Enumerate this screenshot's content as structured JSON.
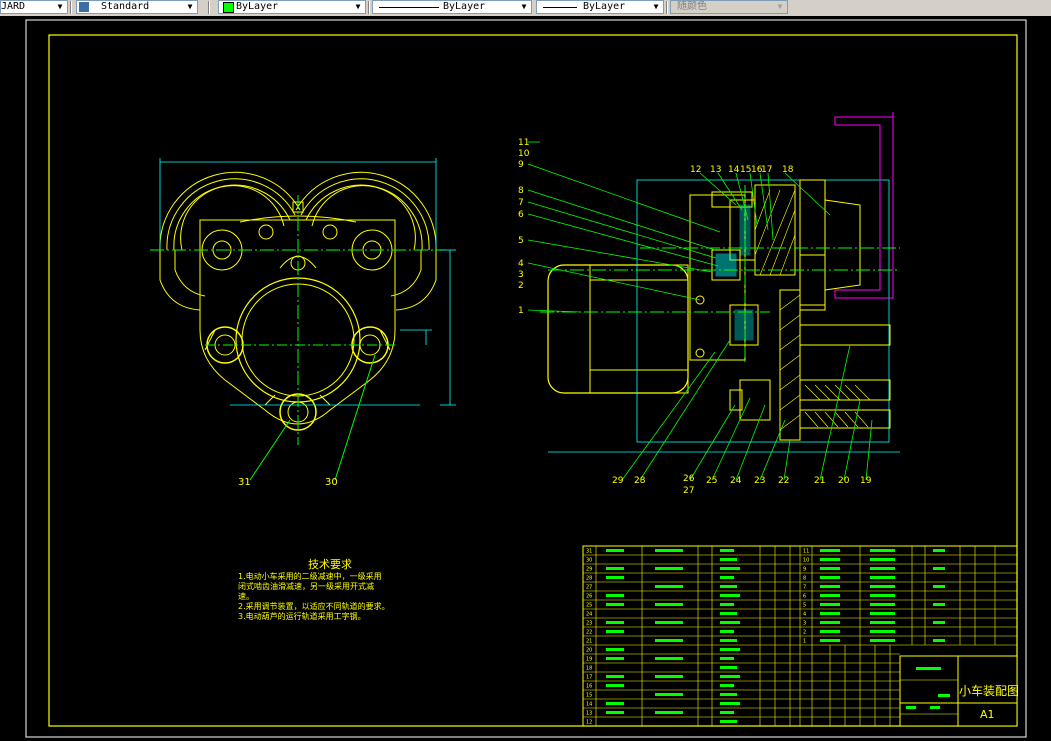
{
  "toolbar": {
    "textstyle_fragment": "JARD",
    "dimstyle": "Standard",
    "layer_color": "ByLayer",
    "linetype": "ByLayer",
    "lineweight": "ByLayer",
    "plotstyle": "随颜色",
    "layer_color_hex": "#00ff00"
  },
  "drawing": {
    "tech_title": "技术要求",
    "tech_notes": [
      "1.电动小车采用的二级减速中，一级采用",
      "    闭式啮齿油滑减速，另一级采用开式减",
      "    速。",
      "2.采用调节装置，以适应不同轨道的要求。",
      "3.电动葫芦的运行轨道采用工字钢。"
    ],
    "drawing_title": "小车装配图",
    "sheet_size": "A1",
    "left_labels": [
      "31",
      "30"
    ],
    "right_labels_left": [
      "11",
      "10",
      "9",
      "8",
      "7",
      "6",
      "5",
      "4",
      "3",
      "2",
      "1"
    ],
    "right_labels_top": [
      "12",
      "13",
      "14",
      "15",
      "16",
      "17",
      "18"
    ],
    "right_labels_bottom": [
      "29",
      "28",
      "26",
      "27",
      "25",
      "24",
      "23",
      "22",
      "21",
      "20",
      "19"
    ],
    "parts_left_col": [
      "31",
      "30",
      "29",
      "28",
      "27",
      "26",
      "25",
      "24",
      "23",
      "22",
      "21",
      "20",
      "19",
      "18",
      "17",
      "16",
      "15",
      "14",
      "13",
      "12"
    ],
    "parts_right_col": [
      "11",
      "10",
      "9",
      "8",
      "7",
      "6",
      "5",
      "4",
      "3",
      "2",
      "1"
    ]
  },
  "colors": {
    "background": "#000000",
    "yellow": "#ffff00",
    "green": "#00ff00",
    "white": "#ffffff",
    "magenta": "#ff00ff",
    "cyan": "#00ffff"
  }
}
